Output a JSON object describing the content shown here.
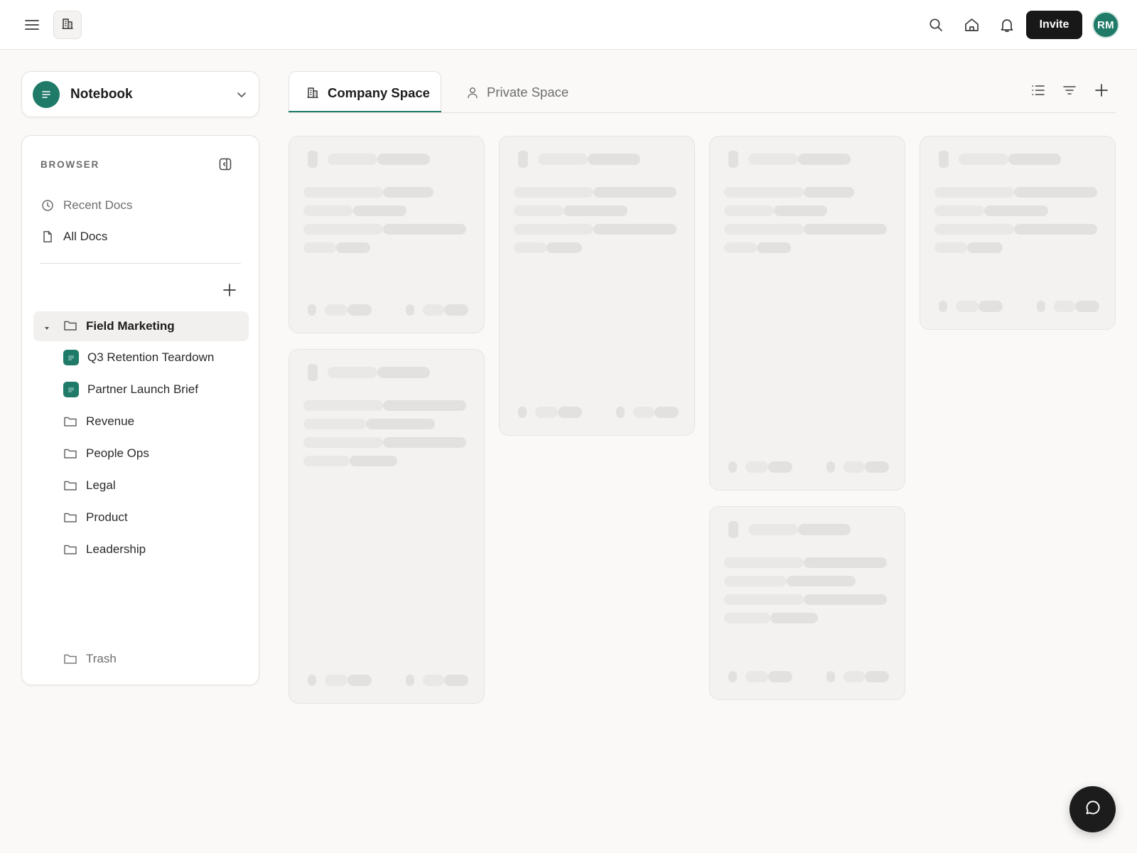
{
  "topbar": {
    "invite_label": "Invite",
    "avatar_initials": "RM",
    "icons": [
      "hamburger-menu-icon",
      "building-icon",
      "search-icon",
      "home-icon",
      "bell-icon"
    ]
  },
  "notebook_selector": {
    "label": "Notebook",
    "icon": "document-lines-icon"
  },
  "sidebar": {
    "heading": "BROWSER",
    "nav_items": [
      {
        "label": "Recent Docs",
        "icon": "clock-icon"
      },
      {
        "label": "All Docs",
        "icon": "file-icon"
      }
    ],
    "active_folder": {
      "label": "Field Marketing",
      "expanded": true
    },
    "documents": [
      {
        "label": "Q3 Retention Teardown"
      },
      {
        "label": "Partner Launch Brief"
      }
    ],
    "folders": [
      {
        "label": "Revenue"
      },
      {
        "label": "People Ops"
      },
      {
        "label": "Legal"
      },
      {
        "label": "Product"
      },
      {
        "label": "Leadership"
      }
    ],
    "trash_label": "Trash"
  },
  "tabs": [
    {
      "label": "Company Space",
      "icon": "building-icon",
      "active": true
    },
    {
      "label": "Private Space",
      "icon": "person-icon",
      "active": false
    }
  ],
  "toolbar_icons": [
    "list-view-icon",
    "filter-icon",
    "plus-icon"
  ],
  "colors": {
    "accent": "#1f7a68",
    "dark": "#181818",
    "background": "#faf9f8",
    "skeleton": "#e9e8e6"
  },
  "chat_icon": "chat-bubble-icon"
}
